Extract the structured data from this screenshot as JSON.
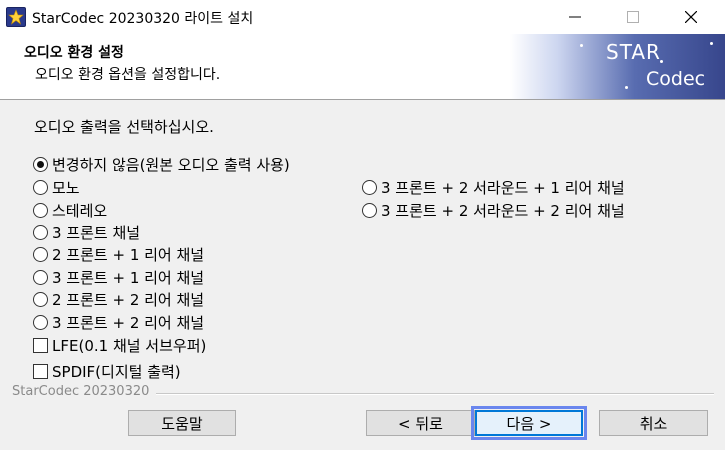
{
  "window": {
    "title": "StarCodec 20230320 라이트 설치",
    "icon": "star-app-icon",
    "controls": [
      "minimize-icon",
      "maximize-icon",
      "close-icon"
    ]
  },
  "header": {
    "title": "오디오 환경 설정",
    "subtitle": "오디오 환경 옵션을 설정합니다.",
    "banner_line1": "STAR",
    "banner_line2": "Codec"
  },
  "main": {
    "prompt": "오디오 출력을 선택하십시오.",
    "options_left": [
      {
        "label": "변경하지 않음(원본 오디오 출력 사용)",
        "selected": true
      },
      {
        "label": "모노",
        "selected": false
      },
      {
        "label": "스테레오",
        "selected": false
      },
      {
        "label": "3 프론트 채널",
        "selected": false
      },
      {
        "label": "2 프론트 + 1 리어 채널",
        "selected": false
      },
      {
        "label": "3 프론트 + 1 리어 채널",
        "selected": false
      },
      {
        "label": "2 프론트 + 2 리어 채널",
        "selected": false
      },
      {
        "label": "3 프론트 + 2 리어 채널",
        "selected": false
      }
    ],
    "options_right": [
      {
        "label": "3 프론트 + 2 서라운드 + 1 리어 채널",
        "selected": false
      },
      {
        "label": "3 프론트 + 2 서라운드 + 2 리어 채널",
        "selected": false
      }
    ],
    "checkboxes": [
      {
        "label": "LFE(0.1 채널 서브우퍼)",
        "checked": false
      },
      {
        "label": "SPDIF(디지털 출력)",
        "checked": false
      }
    ]
  },
  "footer": {
    "brand": "StarCodec 20230320",
    "help_label": "도움말",
    "back_label": "< 뒤로",
    "next_label": "다음 >",
    "cancel_label": "취소"
  },
  "colors": {
    "focus": "#0078d7",
    "banner_dark": "#37468c"
  }
}
